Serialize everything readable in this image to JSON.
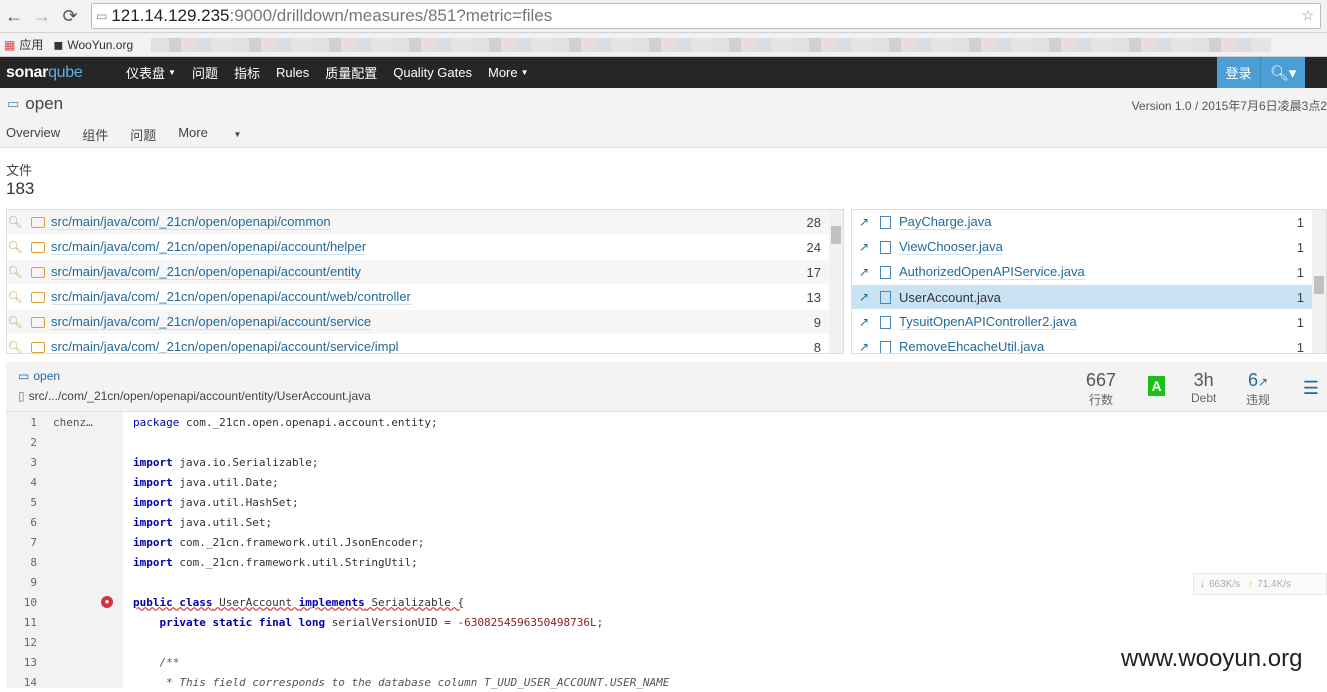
{
  "browser": {
    "url_host": "121.14.129.235",
    "url_path": ":9000/drilldown/measures/851?metric=files",
    "bookmarks": [
      {
        "label": "应用"
      },
      {
        "label": "WooYun.org"
      }
    ]
  },
  "nav": {
    "logo": "sonarqube",
    "items": [
      "仪表盘",
      "问题",
      "指标",
      "Rules",
      "质量配置",
      "Quality Gates",
      "More"
    ],
    "login": "登录"
  },
  "project": {
    "name": "open",
    "version": "Version 1.0 / 2015年7月6日凌晨3点2",
    "tabs": [
      "Overview",
      "组件",
      "问题",
      "More"
    ]
  },
  "metric": {
    "title": "文件",
    "value": "183"
  },
  "directories": [
    {
      "path": "src/main/java/com/_21cn/open/openapi/common",
      "count": "28"
    },
    {
      "path": "src/main/java/com/_21cn/open/openapi/account/helper",
      "count": "24"
    },
    {
      "path": "src/main/java/com/_21cn/open/openapi/account/entity",
      "count": "17"
    },
    {
      "path": "src/main/java/com/_21cn/open/openapi/account/web/controller",
      "count": "13"
    },
    {
      "path": "src/main/java/com/_21cn/open/openapi/account/service",
      "count": "9"
    },
    {
      "path": "src/main/java/com/_21cn/open/openapi/account/service/impl",
      "count": "8"
    }
  ],
  "files": [
    {
      "name": "PayCharge.java",
      "count": "1"
    },
    {
      "name": "ViewChooser.java",
      "count": "1"
    },
    {
      "name": "AuthorizedOpenAPIService.java",
      "count": "1"
    },
    {
      "name": "UserAccount.java",
      "count": "1"
    },
    {
      "name": "TysuitOpenAPIController2.java",
      "count": "1"
    },
    {
      "name": "RemoveEhcacheUtil.java",
      "count": "1"
    }
  ],
  "source": {
    "project_link": "open",
    "file_path": "src/.../com/_21cn/open/openapi/account/entity/UserAccount.java",
    "lines_value": "667",
    "lines_label": "行数",
    "grade": "A",
    "debt_value": "3h",
    "debt_label": "Debt",
    "issues_value": "6",
    "issues_label": "违规",
    "scm_author": "chenz…"
  },
  "code_lines": [
    {
      "n": "1",
      "text": "package com._21cn.open.openapi.account.entity;"
    },
    {
      "n": "2",
      "text": ""
    },
    {
      "n": "3",
      "text": "import java.io.Serializable;"
    },
    {
      "n": "4",
      "text": "import java.util.Date;"
    },
    {
      "n": "5",
      "text": "import java.util.HashSet;"
    },
    {
      "n": "6",
      "text": "import java.util.Set;"
    },
    {
      "n": "7",
      "text": "import com._21cn.framework.util.JsonEncoder;"
    },
    {
      "n": "8",
      "text": "import com._21cn.framework.util.StringUtil;"
    },
    {
      "n": "9",
      "text": ""
    },
    {
      "n": "10",
      "text": "public class UserAccount implements Serializable {"
    },
    {
      "n": "11",
      "text": "    private static final long serialVersionUID = -6308254596350498736L;"
    },
    {
      "n": "12",
      "text": ""
    },
    {
      "n": "13",
      "text": "    /**"
    },
    {
      "n": "14",
      "text": "     * This field corresponds to the database column T_UUD_USER_ACCOUNT.USER_NAME"
    }
  ],
  "netspeed": {
    "down": "663K/s",
    "up": "71.4K/s"
  },
  "watermark": "www.wooyun.org"
}
